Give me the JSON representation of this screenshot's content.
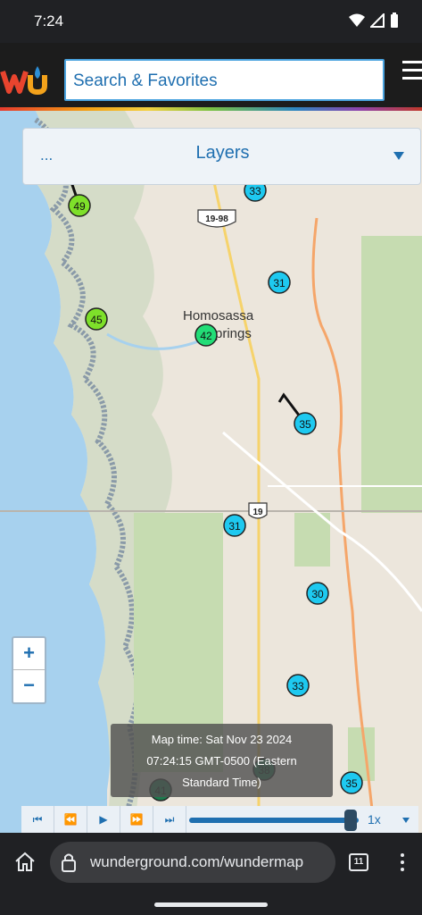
{
  "status": {
    "time": "7:24"
  },
  "header": {
    "logo_alt": "wu",
    "search_placeholder": "Search & Favorites"
  },
  "layers": {
    "dots": "...",
    "title": "Layers"
  },
  "map": {
    "labels": [
      {
        "text": "Homosassa",
        "name": "city-label-homosassa"
      },
      {
        "text": "Springs",
        "name": "city-label-springs"
      }
    ],
    "shields": [
      "19-98",
      "19"
    ],
    "stations": [
      {
        "value": "49",
        "color": "#7ee02a"
      },
      {
        "value": "45",
        "color": "#7ee02a"
      },
      {
        "value": "42",
        "color": "#22dd77"
      },
      {
        "value": "33",
        "color": "#1ec9f0"
      },
      {
        "value": "31",
        "color": "#1ec9f0"
      },
      {
        "value": "35",
        "color": "#1ec9f0"
      },
      {
        "value": "31",
        "color": "#1ec9f0"
      },
      {
        "value": "30",
        "color": "#1ec9f0"
      },
      {
        "value": "33",
        "color": "#1ec9f0"
      },
      {
        "value": "35",
        "color": "#1ec9f0"
      },
      {
        "value": "41",
        "color": "#1e7a4e"
      },
      {
        "value": "38",
        "color": "#1e7a4e"
      }
    ],
    "time_box": {
      "line1": "Map time: Sat Nov 23 2024",
      "line2": "07:24:15 GMT-0500 (Eastern",
      "line3": "Standard Time)"
    }
  },
  "zoom": {
    "in": "+",
    "out": "−"
  },
  "playback": {
    "speed": "1x"
  },
  "browser": {
    "url": "wunderground.com/wundermap",
    "tab_count": "11"
  }
}
